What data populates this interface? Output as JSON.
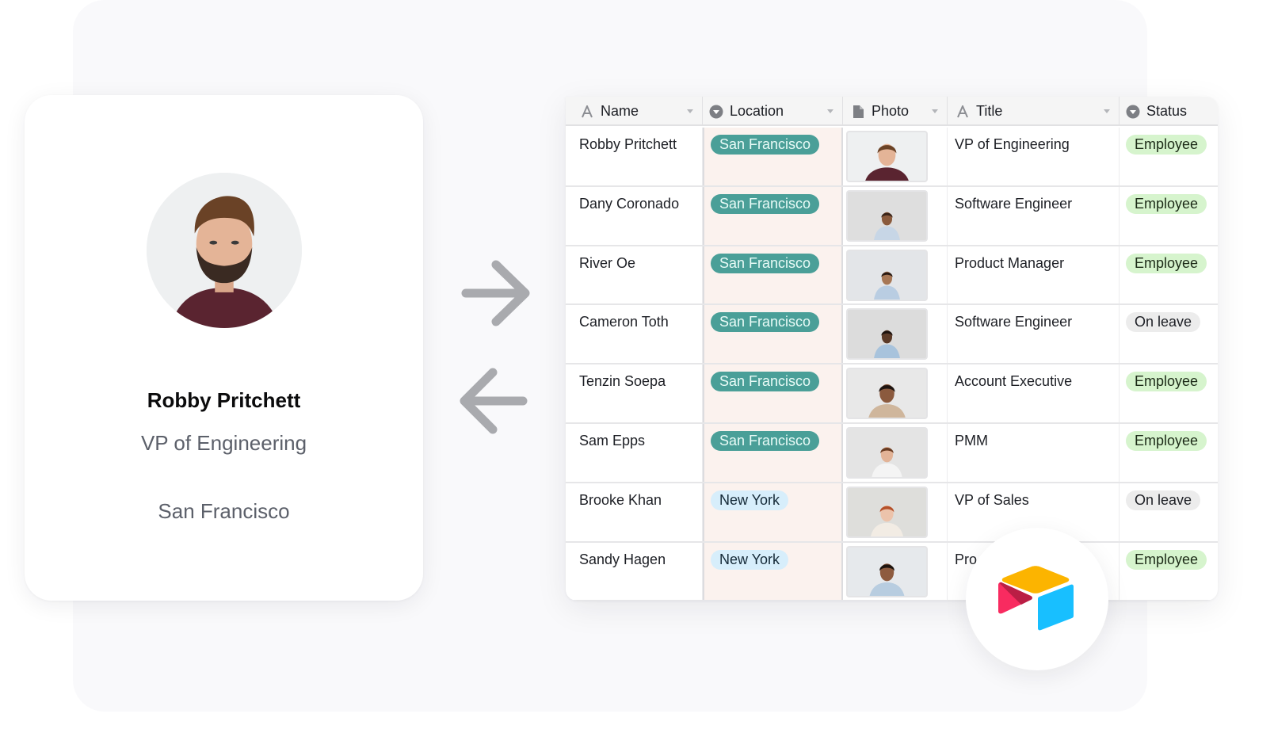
{
  "profile": {
    "name": "Robby Pritchett",
    "title": "VP of Engineering",
    "location": "San Francisco",
    "avatar_icon": "person-photo"
  },
  "sync_arrows": {
    "to_table_icon": "arrow-right-icon",
    "to_profile_icon": "arrow-left-icon"
  },
  "table": {
    "columns": [
      {
        "label": "Name",
        "type_icon": "text-field-icon"
      },
      {
        "label": "Location",
        "type_icon": "single-select-icon"
      },
      {
        "label": "Photo",
        "type_icon": "attachment-icon"
      },
      {
        "label": "Title",
        "type_icon": "text-field-icon"
      },
      {
        "label": "Status",
        "type_icon": "single-select-icon"
      }
    ],
    "rows": [
      {
        "name": "Robby Pritchett",
        "location": "San Francisco",
        "title": "VP of Engineering",
        "status": "Employee"
      },
      {
        "name": "Dany Coronado",
        "location": "San Francisco",
        "title": "Software Engineer",
        "status": "Employee"
      },
      {
        "name": "River Oe",
        "location": "San Francisco",
        "title": "Product Manager",
        "status": "Employee"
      },
      {
        "name": "Cameron Toth",
        "location": "San Francisco",
        "title": "Software Engineer",
        "status": "On leave"
      },
      {
        "name": "Tenzin Soepa",
        "location": "San Francisco",
        "title": "Account Executive",
        "status": "Employee"
      },
      {
        "name": "Sam Epps",
        "location": "San Francisco",
        "title": "PMM",
        "status": "Employee"
      },
      {
        "name": "Brooke Khan",
        "location": "New York",
        "title": "VP of Sales",
        "status": "On leave"
      },
      {
        "name": "Sandy Hagen",
        "location": "New York",
        "title": "Pro",
        "status": "Employee"
      }
    ]
  },
  "colors": {
    "san_francisco_pill": "#4a9f98",
    "new_york_pill": "#d7eefb",
    "employee_pill": "#d6f4cd",
    "on_leave_pill": "#ececec",
    "location_column_bg": "#fbf2ee",
    "logo_yellow": "#fcb400",
    "logo_red": "#f82b60",
    "logo_blue": "#18bfff"
  },
  "brand": {
    "logo_icon": "airtable-logo-icon"
  }
}
